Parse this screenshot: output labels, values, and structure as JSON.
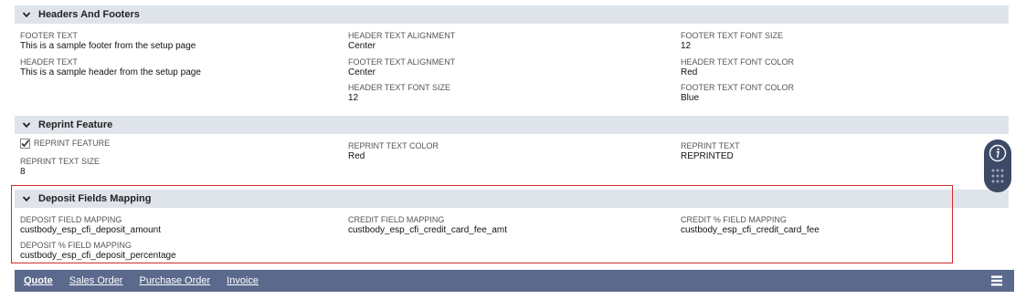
{
  "sections": {
    "headers_footers": {
      "title": "Headers And Footers",
      "fields": [
        {
          "label": "FOOTER TEXT",
          "value": "This is a sample footer from the setup page"
        },
        {
          "label": "HEADER TEXT",
          "value": "This is a sample header from the setup page"
        },
        {
          "label": "HEADER TEXT ALIGNMENT",
          "value": "Center"
        },
        {
          "label": "FOOTER TEXT ALIGNMENT",
          "value": "Center"
        },
        {
          "label": "HEADER TEXT FONT SIZE",
          "value": "12"
        },
        {
          "label": "FOOTER TEXT FONT SIZE",
          "value": "12"
        },
        {
          "label": "HEADER TEXT FONT COLOR",
          "value": "Red"
        },
        {
          "label": "FOOTER TEXT FONT COLOR",
          "value": "Blue"
        }
      ]
    },
    "reprint": {
      "title": "Reprint Feature",
      "checkbox_label": "REPRINT FEATURE",
      "checkbox_checked": true,
      "fields": [
        {
          "label": "REPRINT TEXT SIZE",
          "value": "8"
        },
        {
          "label": "REPRINT TEXT COLOR",
          "value": "Red"
        },
        {
          "label": "REPRINT TEXT",
          "value": "REPRINTED"
        }
      ]
    },
    "deposit": {
      "title": "Deposit Fields Mapping",
      "fields": [
        {
          "label": "DEPOSIT FIELD MAPPING",
          "value": "custbody_esp_cfi_deposit_amount"
        },
        {
          "label": "DEPOSIT % FIELD MAPPING",
          "value": "custbody_esp_cfi_deposit_percentage"
        },
        {
          "label": "CREDIT FIELD MAPPING",
          "value": "custbody_esp_cfi_credit_card_fee_amt"
        },
        {
          "label": "CREDIT % FIELD MAPPING",
          "value": "custbody_esp_cfi_credit_card_fee"
        }
      ]
    }
  },
  "tabs": [
    {
      "label": "Quote",
      "active": true
    },
    {
      "label": "Sales Order",
      "active": false
    },
    {
      "label": "Purchase Order",
      "active": false
    },
    {
      "label": "Invoice",
      "active": false
    }
  ],
  "colors": {
    "section_header_bg": "#dfe4eb",
    "tabbar_bg": "#5b6a8c",
    "highlight_border": "#d42a2a",
    "widget_bg": "#3c4a66"
  },
  "icons": {
    "collapse": "chevron-down-icon",
    "checkbox": "checkmark-icon",
    "info": "info-icon",
    "drag": "grip-dots-icon",
    "menu": "hamburger-menu-icon"
  }
}
